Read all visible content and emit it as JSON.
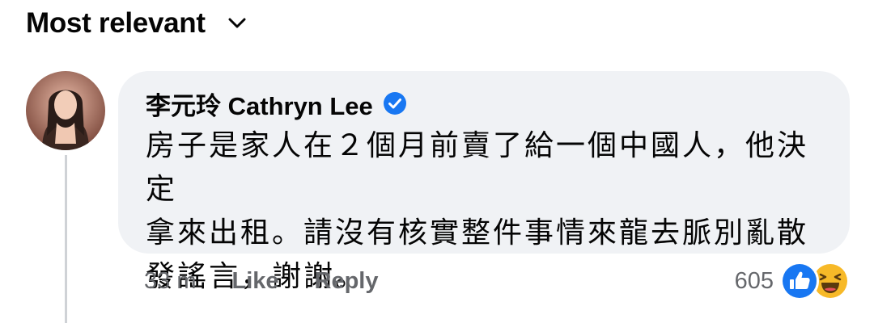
{
  "sort": {
    "label": "Most relevant",
    "icon": "chevron-down-icon"
  },
  "comment": {
    "author": "李元玲 Cathryn Lee",
    "verified_icon": "verified-badge-icon",
    "lines": [
      "房子是家人在２個月前賣了給一個中國人，他決定",
      "拿來出租。請沒有核實整件事情來龍去脈別亂散",
      "發謠言，謝謝。"
    ],
    "time": "33 m",
    "like_label": "Like",
    "reply_label": "Reply",
    "reaction_count": "605",
    "reaction_icons": [
      "like-reaction-icon",
      "haha-reaction-icon"
    ]
  },
  "colors": {
    "bubble": "#f0f2f5",
    "meta_text": "#65676b",
    "verified": "#1877f2",
    "like_reaction": "#1877f2",
    "haha_reaction": "#f7b928"
  }
}
